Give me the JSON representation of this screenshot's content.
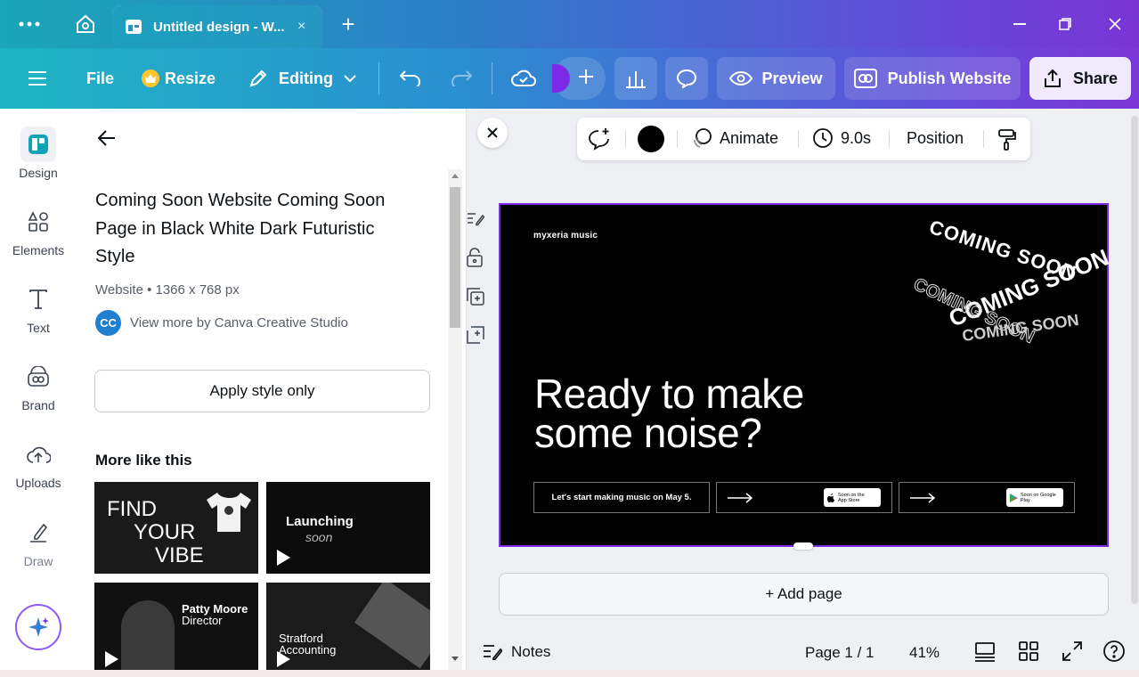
{
  "titlebar": {
    "tab_title": "Untitled design - W...",
    "tab_close": "×",
    "new_tab": "+"
  },
  "toolbar": {
    "file": "File",
    "resize": "Resize",
    "editing": "Editing",
    "preview": "Preview",
    "publish": "Publish Website",
    "share": "Share"
  },
  "rail": {
    "items": [
      {
        "label": "Design",
        "icon": "design-icon"
      },
      {
        "label": "Elements",
        "icon": "elements-icon"
      },
      {
        "label": "Text",
        "icon": "text-icon"
      },
      {
        "label": "Brand",
        "icon": "brand-icon"
      },
      {
        "label": "Uploads",
        "icon": "uploads-icon"
      },
      {
        "label": "Draw",
        "icon": "draw-icon"
      }
    ]
  },
  "panel": {
    "title": "Coming Soon Website Coming Soon Page in Black White Dark Futuristic Style",
    "meta": "Website • 1366 x 768 px",
    "author_initials": "CC",
    "author": "View more by Canva Creative Studio",
    "apply": "Apply style only",
    "more_heading": "More like this",
    "thumbs": [
      {
        "line1": "FIND",
        "line2": "YOUR",
        "line3": "VIBE"
      },
      {
        "line1": "Launching",
        "line2": "soon"
      },
      {
        "line1": "Patty Moore",
        "line2": "Director"
      },
      {
        "line1": "Stratford",
        "line2": "Accounting"
      }
    ]
  },
  "context_bar": {
    "animate": "Animate",
    "duration": "9.0s",
    "position": "Position",
    "color": "#000000"
  },
  "canvas": {
    "brand": "myxeria music",
    "coming_soon": "COMING SOON",
    "headline1": "Ready to make",
    "headline2": "some noise?",
    "cta_text": "Let's start making music on May 5.",
    "app_store": "Soon on the App Store",
    "google_play": "Soon on Google Play"
  },
  "workspace": {
    "add_page": "+ Add page",
    "notes": "Notes",
    "page_indicator": "Page 1 / 1",
    "zoom": "41%"
  },
  "colors": {
    "accent": "#7d2ae8",
    "toolbar_start": "#1fb5c4",
    "toolbar_end": "#7c37d8"
  }
}
